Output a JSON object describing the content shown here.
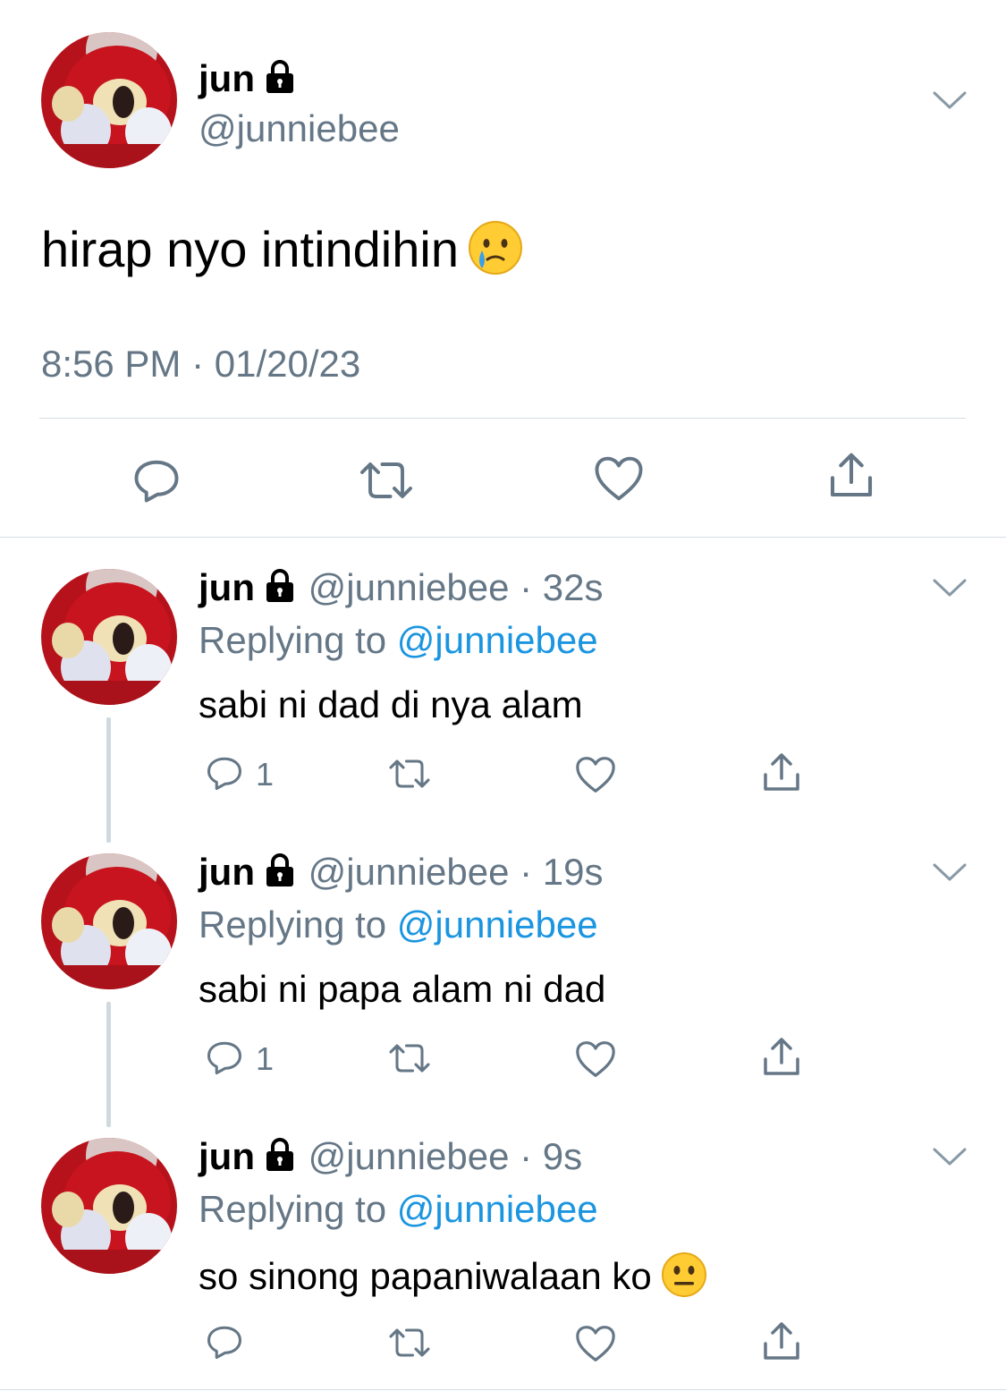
{
  "main_tweet": {
    "display_name": "jun",
    "handle": "@junniebee",
    "text": "hirap nyo intindihin",
    "text_emoji": "crying-face-emoji",
    "timestamp": "8:56 PM · 01/20/23",
    "actions": [
      "reply-icon",
      "retweet-icon",
      "like-icon",
      "share-icon"
    ]
  },
  "replies": [
    {
      "display_name": "jun",
      "handle_and_time": "@junniebee · 32s",
      "replying_prefix": "Replying to ",
      "replying_to": "@junniebee",
      "text": "sabi ni dad di nya alam",
      "reply_count": "1"
    },
    {
      "display_name": "jun",
      "handle_and_time": "@junniebee · 19s",
      "replying_prefix": "Replying to ",
      "replying_to": "@junniebee",
      "text": "sabi ni papa alam ni dad",
      "reply_count": "1"
    },
    {
      "display_name": "jun",
      "handle_and_time": "@junniebee · 9s",
      "replying_prefix": "Replying to ",
      "replying_to": "@junniebee",
      "text": "so sinong papaniwalaan ko",
      "text_emoji": "neutral-face-emoji",
      "reply_count": ""
    }
  ],
  "colors": {
    "secondary_text": "#657786",
    "link": "#1b95e0",
    "divider": "#d6dde3",
    "thread_line": "#cfd9de"
  }
}
